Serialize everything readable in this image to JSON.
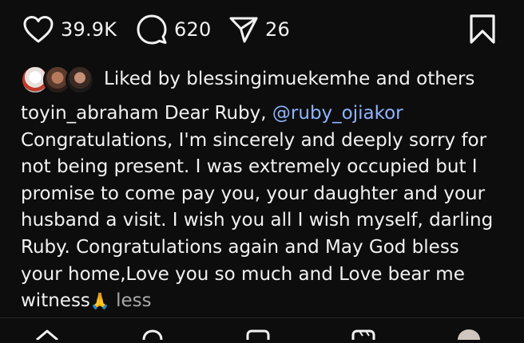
{
  "post_actions": {
    "like_count": "39.9K",
    "comment_count": "620",
    "share_count": "26"
  },
  "liked_by": {
    "text": "Liked by blessingimuekemhe and others"
  },
  "caption": {
    "username": "toyin_abraham",
    "lines": [
      "Dear Ruby,",
      "@ruby_ojiakor",
      "Congratulations, I'm sincerely and deeply sorry for",
      "not being present. I was extremely occupied but I",
      "promise to come pay you, your daughter and your",
      "husband a visit. I wish you all I wish myself, darling",
      "Ruby. Congratulations again and May God bless",
      "your home,Love you so much and Love bear me",
      "witness"
    ],
    "emoji": "🙏",
    "less_label": "less"
  },
  "icons": {
    "like": "heart-icon",
    "comment": "comment-bubble-icon",
    "share": "paper-plane-icon",
    "save": "bookmark-icon",
    "nav": [
      "home-icon",
      "search-icon",
      "create-icon",
      "reels-icon",
      "profile-avatar"
    ]
  }
}
